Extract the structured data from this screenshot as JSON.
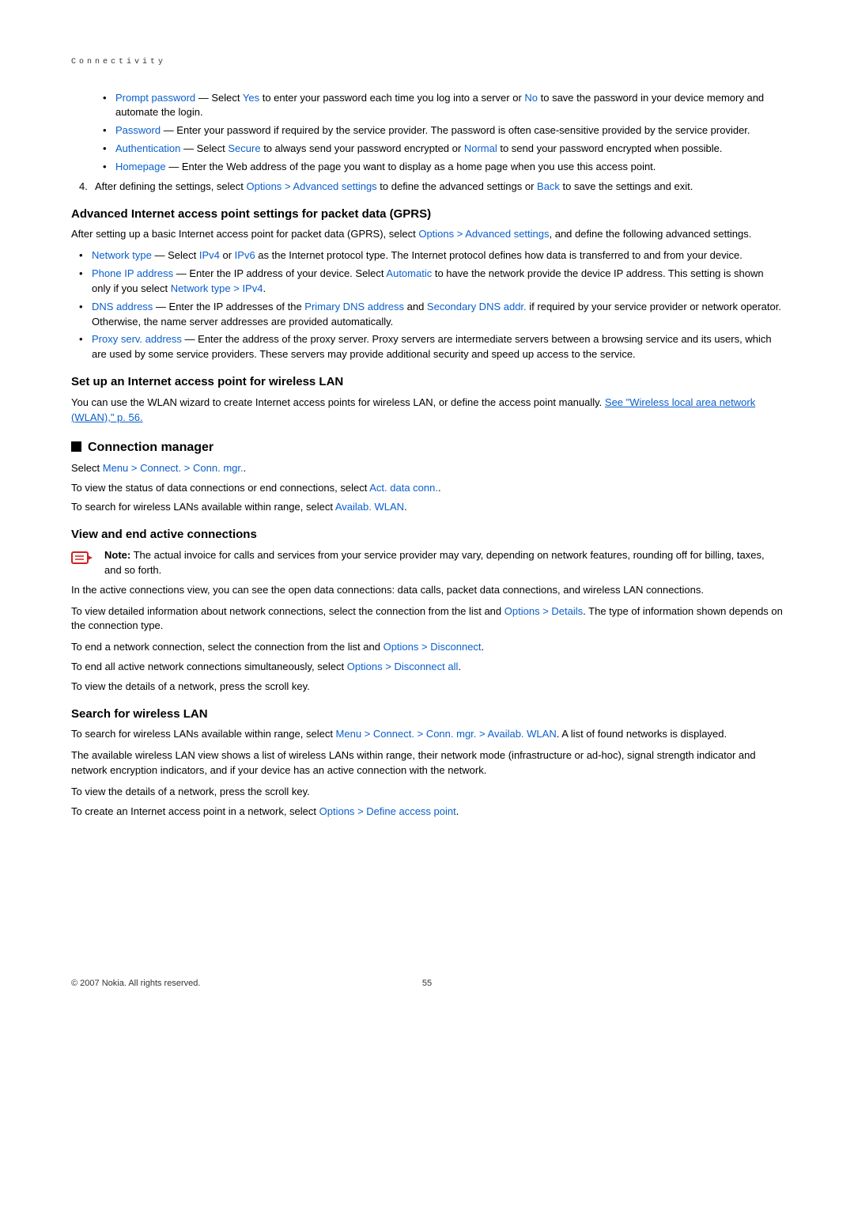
{
  "header": {
    "label": "Connectivity"
  },
  "block1_bullets": [
    {
      "label": "Prompt password",
      "tail": " — Select ",
      "ui1": "Yes",
      "mid": " to enter your password each time you log into a server or ",
      "ui2": "No",
      "end": " to save the password in your device memory and automate the login."
    },
    {
      "label": "Password",
      "tail": " — Enter your password if required by the service provider. The password is often case-sensitive provided by the service provider."
    },
    {
      "label": "Authentication",
      "tail": " — Select ",
      "ui1": "Secure",
      "mid": " to always send your password encrypted or ",
      "ui2": "Normal",
      "end": " to send your password encrypted when possible."
    },
    {
      "label": "Homepage",
      "tail": " — Enter the Web address of the page you want to display as a home page when you use this access point."
    }
  ],
  "step4": {
    "pre": "After defining the settings, select ",
    "opt": "Options",
    "adv": "Advanced settings",
    "mid": " to define the advanced settings or ",
    "back": "Back",
    "end": " to save the settings and exit."
  },
  "h_gprs": "Advanced Internet access point settings for packet data (GPRS)",
  "p_gprs": {
    "pre": "After setting up a basic Internet access point for packet data (GPRS), select ",
    "opt": "Options",
    "adv": "Advanced settings",
    "end": ", and define the following advanced settings."
  },
  "gprs_bullets": {
    "b1": {
      "label": "Network type",
      "tail1": " — Select ",
      "ipv4": "IPv4",
      "or": " or ",
      "ipv6": "IPv6",
      "tail2": " as the Internet protocol type. The Internet protocol defines how data is transferred to and from your device."
    },
    "b2": {
      "label": "Phone IP address",
      "tail1": " — Enter the IP address of your device. Select ",
      "auto": "Automatic",
      "tail2": " to have the network provide the device IP address. This setting is shown only if you select ",
      "nt": "Network type",
      "ipv4": "IPv4",
      "dot": "."
    },
    "b3": {
      "label": "DNS address",
      "tail1": " — Enter the IP addresses of the ",
      "p": "Primary DNS address",
      "and": " and ",
      "s": "Secondary DNS addr.",
      "tail2": " if required by your service provider or network operator. Otherwise, the name server addresses are provided automatically."
    },
    "b4": {
      "label": "Proxy serv. address",
      "tail": " — Enter the address of the proxy server. Proxy servers are intermediate servers between a browsing service and its users, which are used by some service providers. These servers may provide additional security and speed up access to the service."
    }
  },
  "h_wlan": "Set up an Internet access point for wireless LAN",
  "p_wlan": {
    "pre": "You can use the WLAN wizard to create Internet access points for wireless LAN, or define the access point manually. ",
    "link": "See \"Wireless local area network (WLAN),\" p. 56."
  },
  "h_connmgr": "Connection manager",
  "connmgr_select": {
    "pre": "Select ",
    "menu": "Menu",
    "connect": "Connect.",
    "mgr": "Conn. mgr.",
    "dot": "."
  },
  "connmgr_status": {
    "pre": "To view the status of data connections or end connections, select ",
    "ui": "Act. data conn.",
    "dot": "."
  },
  "connmgr_search": {
    "pre": "To search for wireless LANs available within range, select ",
    "ui": "Availab. WLAN",
    "dot": "."
  },
  "h_view": "View and end active connections",
  "note": {
    "label": "Note:",
    "text": "  The actual invoice for calls and services from your service provider may vary, depending on network features, rounding off for billing, taxes, and so forth."
  },
  "view_p1": "In the active connections view, you can see the open data connections: data calls, packet data connections, and wireless LAN connections.",
  "view_p2": {
    "pre": "To view detailed information about network connections, select the connection from the list and ",
    "opt": "Options",
    "det": "Details",
    "end": ". The type of information shown depends on the connection type."
  },
  "view_p3": {
    "pre": "To end a network connection, select the connection from the list and ",
    "opt": "Options",
    "dc": "Disconnect",
    "dot": "."
  },
  "view_p4": {
    "pre": "To end all active network connections simultaneously, select ",
    "opt": "Options",
    "dca": "Disconnect all",
    "dot": "."
  },
  "view_p5": "To view the details of a network, press the scroll key.",
  "h_search": "Search for wireless LAN",
  "search_p1": {
    "pre": "To search for wireless LANs available within range, select ",
    "menu": "Menu",
    "connect": "Connect.",
    "mgr": "Conn. mgr.",
    "wlan": "Availab. WLAN",
    "end": ". A list of found networks is displayed."
  },
  "search_p2": "The available wireless LAN view shows a list of wireless LANs within range, their network mode (infrastructure or ad-hoc), signal strength indicator and network encryption indicators, and if your device has an active connection with the network.",
  "search_p3": "To view the details of a network, press the scroll key.",
  "search_p4": {
    "pre": "To create an Internet access point in a network, select ",
    "opt": "Options",
    "dap": "Define access point",
    "dot": "."
  },
  "footer": {
    "copy": "© 2007 Nokia. All rights reserved.",
    "page": "55"
  }
}
